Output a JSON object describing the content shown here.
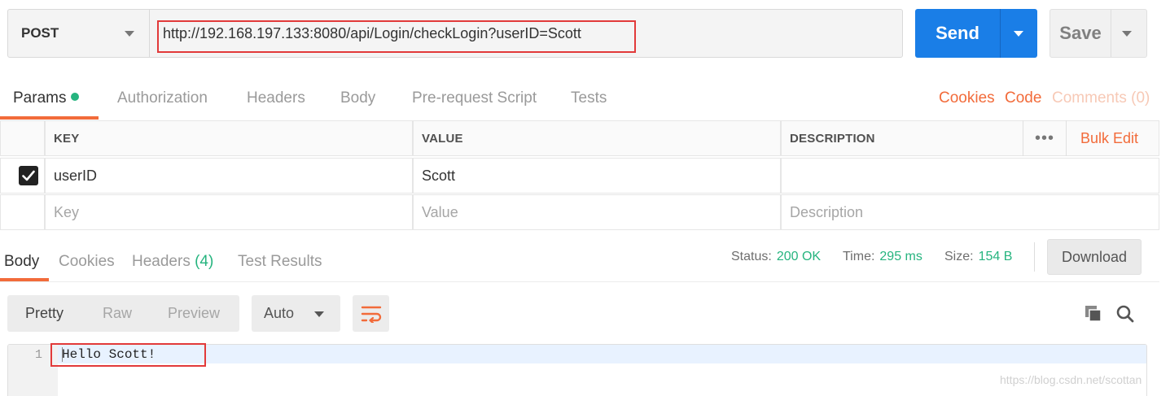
{
  "request": {
    "method": "POST",
    "url": "http://192.168.197.133:8080/api/Login/checkLogin?userID=Scott",
    "send_label": "Send",
    "save_label": "Save"
  },
  "request_tabs": [
    "Params",
    "Authorization",
    "Headers",
    "Body",
    "Pre-request Script",
    "Tests"
  ],
  "request_links": {
    "cookies": "Cookies",
    "code": "Code",
    "comments": "Comments (0)"
  },
  "params": {
    "headers": {
      "key": "KEY",
      "value": "VALUE",
      "description": "DESCRIPTION"
    },
    "more_label": "•••",
    "bulk_edit": "Bulk Edit",
    "rows": [
      {
        "checked": true,
        "key": "userID",
        "value": "Scott",
        "description": ""
      }
    ],
    "placeholders": {
      "key": "Key",
      "value": "Value",
      "description": "Description"
    }
  },
  "response_tabs": {
    "body": "Body",
    "cookies": "Cookies",
    "headers": "Headers",
    "headers_count": "(4)",
    "test_results": "Test Results"
  },
  "status": {
    "status_label": "Status:",
    "status_value": "200 OK",
    "time_label": "Time:",
    "time_value": "295 ms",
    "size_label": "Size:",
    "size_value": "154 B"
  },
  "download_label": "Download",
  "view_modes": [
    "Pretty",
    "Raw",
    "Preview"
  ],
  "format": "Auto",
  "code": {
    "line_numbers": [
      "1"
    ],
    "lines": [
      "Hello Scott!"
    ]
  },
  "watermark": "https://blog.csdn.net/scottan",
  "colors": {
    "accent": "#f26b3a",
    "send_blue": "#1a7ee7",
    "success_green": "#26b47f",
    "annotation_red": "#e23a3a"
  },
  "icons": [
    "chevron-down-icon",
    "checkmark-icon",
    "wrap-lines-icon",
    "copy-icon",
    "search-icon"
  ]
}
